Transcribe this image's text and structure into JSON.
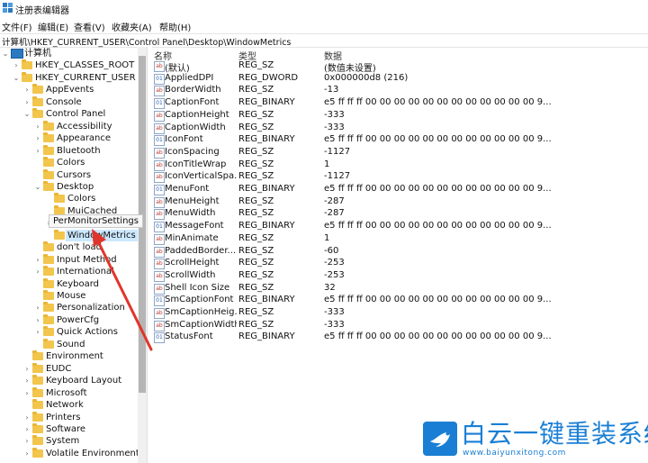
{
  "window": {
    "title": "注册表编辑器"
  },
  "menu": [
    "文件(F)",
    "编辑(E)",
    "查看(V)",
    "收藏夹(A)",
    "帮助(H)"
  ],
  "address": "计算机\\HKEY_CURRENT_USER\\Control Panel\\Desktop\\WindowMetrics",
  "tree": [
    {
      "label": "计算机",
      "indent": 0,
      "exp": "v",
      "icon": "pc"
    },
    {
      "label": "HKEY_CLASSES_ROOT",
      "indent": 1,
      "exp": ">"
    },
    {
      "label": "HKEY_CURRENT_USER",
      "indent": 1,
      "exp": "v"
    },
    {
      "label": "AppEvents",
      "indent": 2,
      "exp": ">"
    },
    {
      "label": "Console",
      "indent": 2,
      "exp": ">"
    },
    {
      "label": "Control Panel",
      "indent": 2,
      "exp": "v"
    },
    {
      "label": "Accessibility",
      "indent": 3,
      "exp": ">"
    },
    {
      "label": "Appearance",
      "indent": 3,
      "exp": ">"
    },
    {
      "label": "Bluetooth",
      "indent": 3,
      "exp": ">"
    },
    {
      "label": "Colors",
      "indent": 3,
      "exp": ""
    },
    {
      "label": "Cursors",
      "indent": 3,
      "exp": ""
    },
    {
      "label": "Desktop",
      "indent": 3,
      "exp": "v"
    },
    {
      "label": "Colors",
      "indent": 4,
      "exp": ""
    },
    {
      "label": "MuiCached",
      "indent": 4,
      "exp": ""
    },
    {
      "label": "PerMonitorSettings",
      "indent": 4,
      "exp": ">"
    },
    {
      "label": "WindowMetrics",
      "indent": 4,
      "exp": "",
      "selected": true
    },
    {
      "label": "don't load",
      "indent": 3,
      "exp": ""
    },
    {
      "label": "Input Method",
      "indent": 3,
      "exp": ">"
    },
    {
      "label": "International",
      "indent": 3,
      "exp": ">"
    },
    {
      "label": "Keyboard",
      "indent": 3,
      "exp": ""
    },
    {
      "label": "Mouse",
      "indent": 3,
      "exp": ""
    },
    {
      "label": "Personalization",
      "indent": 3,
      "exp": ">"
    },
    {
      "label": "PowerCfg",
      "indent": 3,
      "exp": ">"
    },
    {
      "label": "Quick Actions",
      "indent": 3,
      "exp": ">"
    },
    {
      "label": "Sound",
      "indent": 3,
      "exp": ""
    },
    {
      "label": "Environment",
      "indent": 2,
      "exp": ""
    },
    {
      "label": "EUDC",
      "indent": 2,
      "exp": ">"
    },
    {
      "label": "Keyboard Layout",
      "indent": 2,
      "exp": ">"
    },
    {
      "label": "Microsoft",
      "indent": 2,
      "exp": ">"
    },
    {
      "label": "Network",
      "indent": 2,
      "exp": ""
    },
    {
      "label": "Printers",
      "indent": 2,
      "exp": ">"
    },
    {
      "label": "Software",
      "indent": 2,
      "exp": ">"
    },
    {
      "label": "System",
      "indent": 2,
      "exp": ">"
    },
    {
      "label": "Volatile Environment",
      "indent": 2,
      "exp": ">"
    }
  ],
  "tooltip": "PerMonitorSettings",
  "columns": {
    "name": "名称",
    "type": "类型",
    "data": "数据"
  },
  "values": [
    {
      "name": "(默认)",
      "type": "REG_SZ",
      "data": "(数值未设置)",
      "kind": "sz"
    },
    {
      "name": "AppliedDPI",
      "type": "REG_DWORD",
      "data": "0x000000d8 (216)",
      "kind": "bin"
    },
    {
      "name": "BorderWidth",
      "type": "REG_SZ",
      "data": "-13",
      "kind": "sz"
    },
    {
      "name": "CaptionFont",
      "type": "REG_BINARY",
      "data": "e5 ff ff ff 00 00 00 00 00 00 00 00 00 00 00 00 9...",
      "kind": "bin"
    },
    {
      "name": "CaptionHeight",
      "type": "REG_SZ",
      "data": "-333",
      "kind": "sz"
    },
    {
      "name": "CaptionWidth",
      "type": "REG_SZ",
      "data": "-333",
      "kind": "sz"
    },
    {
      "name": "IconFont",
      "type": "REG_BINARY",
      "data": "e5 ff ff ff 00 00 00 00 00 00 00 00 00 00 00 00 9...",
      "kind": "bin"
    },
    {
      "name": "IconSpacing",
      "type": "REG_SZ",
      "data": "-1127",
      "kind": "sz"
    },
    {
      "name": "IconTitleWrap",
      "type": "REG_SZ",
      "data": "1",
      "kind": "sz"
    },
    {
      "name": "IconVerticalSpa...",
      "type": "REG_SZ",
      "data": "-1127",
      "kind": "sz"
    },
    {
      "name": "MenuFont",
      "type": "REG_BINARY",
      "data": "e5 ff ff ff 00 00 00 00 00 00 00 00 00 00 00 00 9...",
      "kind": "bin"
    },
    {
      "name": "MenuHeight",
      "type": "REG_SZ",
      "data": "-287",
      "kind": "sz"
    },
    {
      "name": "MenuWidth",
      "type": "REG_SZ",
      "data": "-287",
      "kind": "sz"
    },
    {
      "name": "MessageFont",
      "type": "REG_BINARY",
      "data": "e5 ff ff ff 00 00 00 00 00 00 00 00 00 00 00 00 9...",
      "kind": "bin"
    },
    {
      "name": "MinAnimate",
      "type": "REG_SZ",
      "data": "1",
      "kind": "sz"
    },
    {
      "name": "PaddedBorder...",
      "type": "REG_SZ",
      "data": "-60",
      "kind": "sz"
    },
    {
      "name": "ScrollHeight",
      "type": "REG_SZ",
      "data": "-253",
      "kind": "sz"
    },
    {
      "name": "ScrollWidth",
      "type": "REG_SZ",
      "data": "-253",
      "kind": "sz"
    },
    {
      "name": "Shell Icon Size",
      "type": "REG_SZ",
      "data": "32",
      "kind": "sz"
    },
    {
      "name": "SmCaptionFont",
      "type": "REG_BINARY",
      "data": "e5 ff ff ff 00 00 00 00 00 00 00 00 00 00 00 00 9...",
      "kind": "bin"
    },
    {
      "name": "SmCaptionHeig...",
      "type": "REG_SZ",
      "data": "-333",
      "kind": "sz"
    },
    {
      "name": "SmCaptionWidth",
      "type": "REG_SZ",
      "data": "-333",
      "kind": "sz"
    },
    {
      "name": "StatusFont",
      "type": "REG_BINARY",
      "data": "e5 ff ff ff 00 00 00 00 00 00 00 00 00 00 00 00 9...",
      "kind": "bin"
    }
  ],
  "watermark": {
    "title": "白云一键重装系统",
    "url": "www.baiyunxitong.com"
  },
  "colors": {
    "selection": "#cce8ff",
    "folder": "#f2c54c",
    "arrow": "#e0352b",
    "brand": "#1a7fd4"
  }
}
